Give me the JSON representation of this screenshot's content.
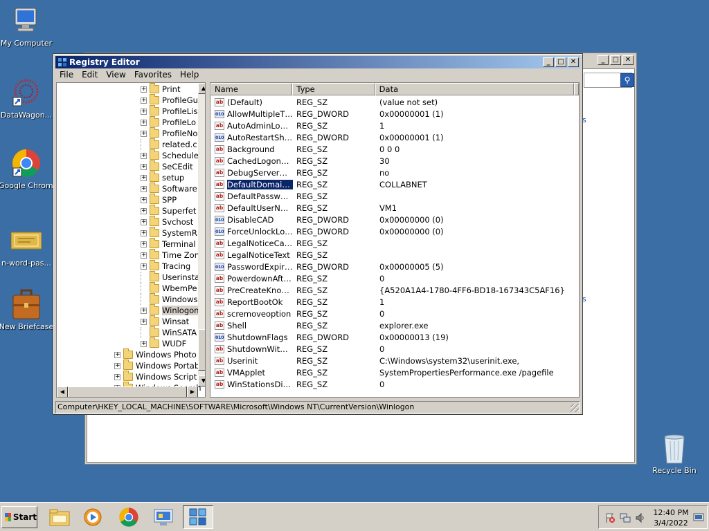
{
  "desktop": {
    "icons": [
      {
        "label": "My Computer",
        "icon": "my-computer-icon"
      },
      {
        "label": "DataWagon...",
        "icon": "datawagon-icon"
      },
      {
        "label": "Google Chrome",
        "icon": "chrome-icon"
      },
      {
        "label": "n-word-pas...",
        "icon": "certificate-file-icon"
      },
      {
        "label": "New Briefcase",
        "icon": "briefcase-icon"
      },
      {
        "label": "Recycle Bin",
        "icon": "recycle-bin-icon"
      }
    ]
  },
  "bg_window": {
    "links": [
      "s",
      "s"
    ],
    "search_icon": "magnifier-icon"
  },
  "regedit": {
    "title": "Registry Editor",
    "menu": [
      "File",
      "Edit",
      "View",
      "Favorites",
      "Help"
    ],
    "tree": [
      {
        "label": "Print",
        "expandable": true,
        "level": 1
      },
      {
        "label": "ProfileGu",
        "expandable": true,
        "level": 1
      },
      {
        "label": "ProfileLis",
        "expandable": true,
        "level": 1
      },
      {
        "label": "ProfileLo",
        "expandable": true,
        "level": 1
      },
      {
        "label": "ProfileNo",
        "expandable": true,
        "level": 1
      },
      {
        "label": "related.c",
        "expandable": false,
        "level": 1
      },
      {
        "label": "Schedule",
        "expandable": true,
        "level": 1
      },
      {
        "label": "SeCEdit",
        "expandable": true,
        "level": 1
      },
      {
        "label": "setup",
        "expandable": true,
        "level": 1
      },
      {
        "label": "Software",
        "expandable": true,
        "level": 1
      },
      {
        "label": "SPP",
        "expandable": true,
        "level": 1
      },
      {
        "label": "Superfet",
        "expandable": true,
        "level": 1
      },
      {
        "label": "Svchost",
        "expandable": true,
        "level": 1
      },
      {
        "label": "SystemR",
        "expandable": true,
        "level": 1
      },
      {
        "label": "Terminal",
        "expandable": true,
        "level": 1
      },
      {
        "label": "Time Zon",
        "expandable": true,
        "level": 1
      },
      {
        "label": "Tracing",
        "expandable": true,
        "level": 1
      },
      {
        "label": "Userinsta",
        "expandable": false,
        "level": 1
      },
      {
        "label": "WbemPe",
        "expandable": false,
        "level": 1
      },
      {
        "label": "Windows",
        "expandable": false,
        "level": 1
      },
      {
        "label": "Winlogon",
        "expandable": true,
        "level": 1,
        "selected": true
      },
      {
        "label": "Winsat",
        "expandable": true,
        "level": 1
      },
      {
        "label": "WinSATA",
        "expandable": false,
        "level": 1
      },
      {
        "label": "WUDF",
        "expandable": true,
        "level": 1
      },
      {
        "label": "Windows Photo V",
        "expandable": true,
        "level": 0
      },
      {
        "label": "Windows Portabl",
        "expandable": true,
        "level": 0
      },
      {
        "label": "Windows Script H",
        "expandable": true,
        "level": 0
      },
      {
        "label": "Windows Search",
        "expandable": true,
        "level": 0
      }
    ],
    "columns": [
      "Name",
      "Type",
      "Data"
    ],
    "values": [
      {
        "name": "(Default)",
        "type": "REG_SZ",
        "data": "(value not set)"
      },
      {
        "name": "AllowMultipleTSS...",
        "type": "REG_DWORD",
        "data": "0x00000001 (1)"
      },
      {
        "name": "AutoAdminLogon",
        "type": "REG_SZ",
        "data": "1"
      },
      {
        "name": "AutoRestartShell",
        "type": "REG_DWORD",
        "data": "0x00000001 (1)"
      },
      {
        "name": "Background",
        "type": "REG_SZ",
        "data": "0 0 0"
      },
      {
        "name": "CachedLogonsCo...",
        "type": "REG_SZ",
        "data": "30"
      },
      {
        "name": "DebugServerCom...",
        "type": "REG_SZ",
        "data": "no"
      },
      {
        "name": "DefaultDomainNa...",
        "type": "REG_SZ",
        "data": "COLLABNET",
        "selected": true
      },
      {
        "name": "DefaultPassword",
        "type": "REG_SZ",
        "data": ""
      },
      {
        "name": "DefaultUserName",
        "type": "REG_SZ",
        "data": "VM1"
      },
      {
        "name": "DisableCAD",
        "type": "REG_DWORD",
        "data": "0x00000000 (0)"
      },
      {
        "name": "ForceUnlockLogon",
        "type": "REG_DWORD",
        "data": "0x00000000 (0)"
      },
      {
        "name": "LegalNoticeCaption",
        "type": "REG_SZ",
        "data": ""
      },
      {
        "name": "LegalNoticeText",
        "type": "REG_SZ",
        "data": ""
      },
      {
        "name": "PasswordExpiry...",
        "type": "REG_DWORD",
        "data": "0x00000005 (5)"
      },
      {
        "name": "PowerdownAfter...",
        "type": "REG_SZ",
        "data": "0"
      },
      {
        "name": "PreCreateKnown...",
        "type": "REG_SZ",
        "data": "{A520A1A4-1780-4FF6-BD18-167343C5AF16}"
      },
      {
        "name": "ReportBootOk",
        "type": "REG_SZ",
        "data": "1"
      },
      {
        "name": "scremoveoption",
        "type": "REG_SZ",
        "data": "0"
      },
      {
        "name": "Shell",
        "type": "REG_SZ",
        "data": "explorer.exe"
      },
      {
        "name": "ShutdownFlags",
        "type": "REG_DWORD",
        "data": "0x00000013 (19)"
      },
      {
        "name": "ShutdownWithou...",
        "type": "REG_SZ",
        "data": "0"
      },
      {
        "name": "Userinit",
        "type": "REG_SZ",
        "data": "C:\\Windows\\system32\\userinit.exe,"
      },
      {
        "name": "VMApplet",
        "type": "REG_SZ",
        "data": "SystemPropertiesPerformance.exe /pagefile"
      },
      {
        "name": "WinStationsDisab...",
        "type": "REG_SZ",
        "data": "0"
      }
    ],
    "status": "Computer\\HKEY_LOCAL_MACHINE\\SOFTWARE\\Microsoft\\Windows NT\\CurrentVersion\\Winlogon",
    "type_icon_labels": {
      "sz": "ab",
      "dword": "010"
    }
  },
  "taskbar": {
    "start_label": "Start",
    "buttons": [
      "explorer-icon",
      "media-player-icon",
      "chrome-icon",
      "server-manager-icon",
      "regedit-icon"
    ],
    "clock_time": "12:40 PM",
    "clock_date": "3/4/2022"
  },
  "colors": {
    "desktop": "#3a6ea5",
    "title_active": "#0a246a",
    "selection": "#0a246a"
  }
}
